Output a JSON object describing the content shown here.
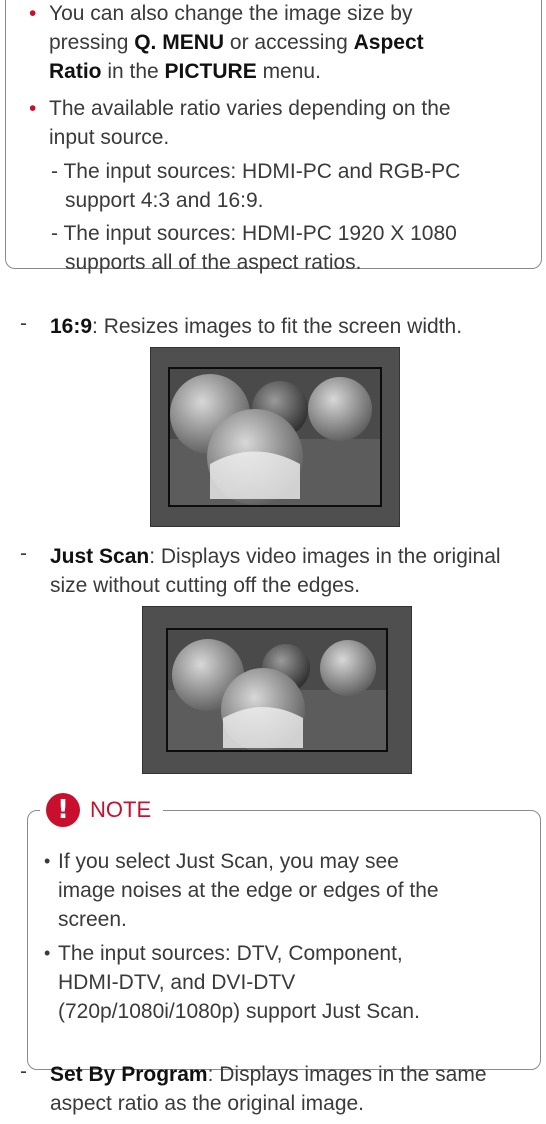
{
  "top_box": {
    "bullet1": {
      "p1": "You can also change the image size by",
      "p2": "pressing ",
      "b1": "Q. MENU",
      "p3": " or accessing ",
      "b2": "Aspect",
      "b3": "Ratio",
      "p4": " in the ",
      "b4": "PICTURE",
      "p5": " menu."
    },
    "bullet2": {
      "line1": "The available ratio varies depending on the",
      "line2": "input source."
    },
    "sub1": {
      "line1": "- The input sources: HDMI-PC and RGB-PC",
      "line2": "support 4:3 and 16:9."
    },
    "sub2": {
      "line1": "- The input sources: HDMI-PC 1920 X 1080",
      "line2": "supports all of the aspect ratios."
    }
  },
  "items": [
    {
      "dash": "-",
      "term": "16:9",
      "desc1": ": Resizes images to fit the screen width.",
      "desc2": ""
    },
    {
      "dash": "-",
      "term": "Just Scan",
      "desc1": ": Displays video images in the original",
      "desc2": "size without cutting off the edges."
    },
    {
      "dash": "-",
      "term": "Set By Program",
      "desc1": ": Displays images in the same",
      "desc2": "aspect ratio as the original image."
    }
  ],
  "note": {
    "icon": "!",
    "title": "NOTE",
    "bullets": [
      {
        "line1": "If you select Just Scan, you may see",
        "line2": "image noises at the edge or edges of the",
        "line3": "screen."
      },
      {
        "line1": "The input sources: DTV, Component,",
        "line2": "HDMI-DTV, and DVI-DTV",
        "line3": "(720p/1080i/1080p) support Just Scan."
      }
    ]
  },
  "icons": {
    "note": "exclamation-icon",
    "image1": "spheres-photo",
    "image2": "spheres-photo"
  },
  "colors": {
    "accent": "#c8102e",
    "text": "#3a3a3a"
  }
}
